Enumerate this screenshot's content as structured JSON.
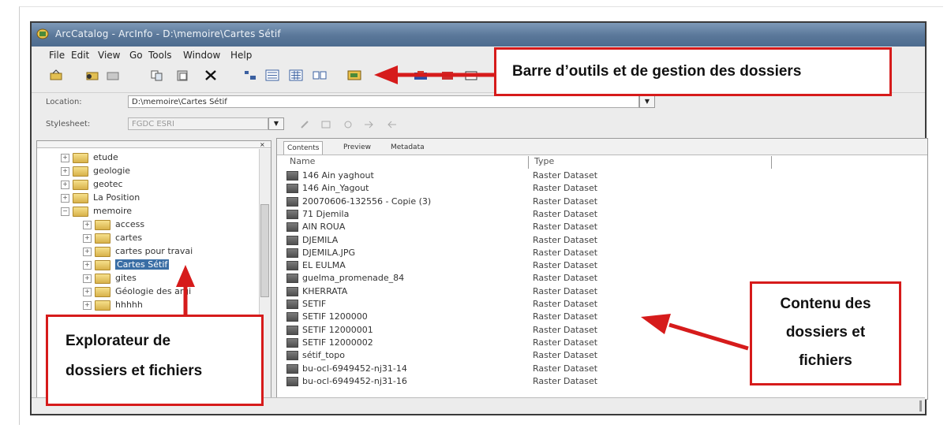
{
  "window": {
    "title": "ArcCatalog - ArcInfo - D:\\memoire\\Cartes Sétif"
  },
  "menu": [
    "File",
    "Edit",
    "View",
    "Go",
    "Tools",
    "Window",
    "Help"
  ],
  "location": {
    "label": "Location:",
    "value": "D:\\memoire\\Cartes Sétif"
  },
  "stylesheet": {
    "label": "Stylesheet:",
    "value": "FGDC ESRI"
  },
  "tree": [
    {
      "label": "etude",
      "level": 1,
      "expander": "+"
    },
    {
      "label": "geologie",
      "level": 1,
      "expander": "+"
    },
    {
      "label": "geotec",
      "level": 1,
      "expander": "+"
    },
    {
      "label": "La Position",
      "level": 1,
      "expander": "+"
    },
    {
      "label": "memoire",
      "level": 1,
      "expander": "−"
    },
    {
      "label": "access",
      "level": 2,
      "expander": "+"
    },
    {
      "label": "cartes",
      "level": 2,
      "expander": "+"
    },
    {
      "label": "cartes pour travai",
      "level": 2,
      "expander": "+"
    },
    {
      "label": "Cartes Sétif",
      "level": 2,
      "expander": "+",
      "selected": true
    },
    {
      "label": "gites",
      "level": 2,
      "expander": "+"
    },
    {
      "label": "Géologie des argi",
      "level": 2,
      "expander": "+"
    },
    {
      "label": "hhhhh",
      "level": 2,
      "expander": "+"
    }
  ],
  "tabs": [
    "Contents",
    "Preview",
    "Metadata"
  ],
  "columns": {
    "name": "Name",
    "type": "Type"
  },
  "files": [
    {
      "name": "146 Ain yaghout",
      "type": "Raster Dataset"
    },
    {
      "name": "146 Ain_Yagout",
      "type": "Raster Dataset"
    },
    {
      "name": "20070606-132556 - Copie (3)",
      "type": "Raster Dataset"
    },
    {
      "name": "71 Djemila",
      "type": "Raster Dataset"
    },
    {
      "name": "AIN ROUA",
      "type": "Raster Dataset"
    },
    {
      "name": "DJEMILA",
      "type": "Raster Dataset"
    },
    {
      "name": "DJEMILA.JPG",
      "type": "Raster Dataset"
    },
    {
      "name": "EL EULMA",
      "type": "Raster Dataset"
    },
    {
      "name": "guelma_promenade_84",
      "type": "Raster Dataset"
    },
    {
      "name": "KHERRATA",
      "type": "Raster Dataset"
    },
    {
      "name": "SETIF",
      "type": "Raster Dataset"
    },
    {
      "name": "SETIF 1200000",
      "type": "Raster Dataset"
    },
    {
      "name": "SETIF 12000001",
      "type": "Raster Dataset"
    },
    {
      "name": "SETIF 12000002",
      "type": "Raster Dataset"
    },
    {
      "name": "sétif_topo",
      "type": "Raster Dataset"
    },
    {
      "name": "bu-ocl-6949452-nj31-14",
      "type": "Raster Dataset"
    },
    {
      "name": "bu-ocl-6949452-nj31-16",
      "type": "Raster Dataset"
    }
  ],
  "callouts": {
    "toolbar": "Barre d’outils et de gestion des dossiers",
    "explorer": [
      "Explorateur de",
      "dossiers et fichiers"
    ],
    "content": [
      "Contenu des",
      "dossiers et",
      "fichiers"
    ]
  },
  "colors": {
    "callout_border": "#d61b1b",
    "arrow": "#d61b1b"
  },
  "icons": [
    "arccatalog-app-icon",
    "connect-folder-icon",
    "disconnect-folder-icon",
    "copy-icon",
    "paste-icon",
    "delete-icon",
    "large-icons-icon",
    "list-icon",
    "details-icon",
    "thumbnails-icon",
    "arcmap-icon",
    "arctoolbox-icon",
    "dropdown-arrow-icon",
    "folder-icon",
    "raster-dataset-icon"
  ]
}
